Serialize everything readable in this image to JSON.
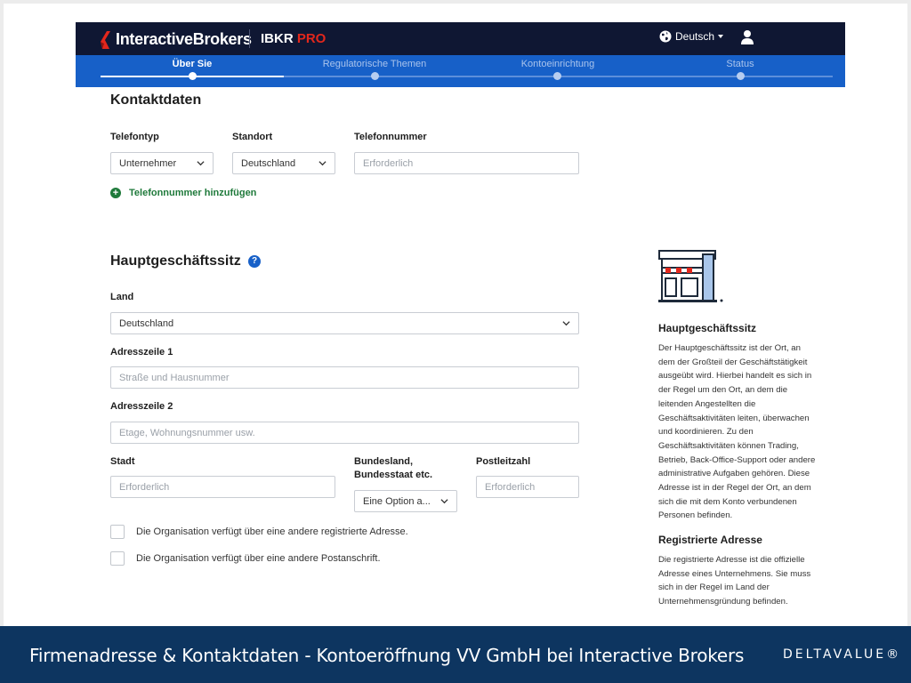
{
  "header": {
    "brand_name": "InteractiveBrokers",
    "product": "IBKR",
    "product_suffix": "PRO",
    "language": "Deutsch"
  },
  "steps": [
    {
      "label": "Über Sie",
      "active": true
    },
    {
      "label": "Regulatorische Themen",
      "active": false
    },
    {
      "label": "Kontoeinrichtung",
      "active": false
    },
    {
      "label": "Status",
      "active": false
    }
  ],
  "contact": {
    "title": "Kontaktdaten",
    "phone_type_label": "Telefontyp",
    "phone_type_value": "Unternehmer",
    "location_label": "Standort",
    "location_value": "Deutschland",
    "phone_label": "Telefonnummer",
    "phone_placeholder": "Erforderlich",
    "add_phone": "Telefonnummer hinzufügen"
  },
  "hq": {
    "title": "Hauptgeschäftssitz",
    "help": "?",
    "country_label": "Land",
    "country_value": "Deutschland",
    "address1_label": "Adresszeile 1",
    "address1_placeholder": "Straße und Hausnummer",
    "address2_label": "Adresszeile 2",
    "address2_placeholder": "Etage, Wohnungsnummer usw.",
    "city_label": "Stadt",
    "city_placeholder": "Erforderlich",
    "state_label_1": "Bundesland,",
    "state_label_2": "Bundesstaat etc.",
    "state_value": "Eine Option a...",
    "zip_label": "Postleitzahl",
    "zip_placeholder": "Erforderlich",
    "checkbox_registered": "Die Organisation verfügt über eine andere registrierte Adresse.",
    "checkbox_postal": "Die Organisation verfügt über eine andere Postanschrift."
  },
  "side": {
    "title1": "Hauptgeschäftssitz",
    "text1": [
      "Der Hauptgeschäftssitz ist der Ort, an",
      "dem der Großteil der Geschäftstätigkeit",
      "ausgeübt wird. Hierbei handelt es sich in",
      "der Regel um den Ort, an dem die",
      "leitenden Angestellten die",
      "Geschäftsaktivitäten leiten, überwachen",
      "und koordinieren. Zu den",
      "Geschäftsaktivitäten können Trading,",
      "Betrieb, Back-Office-Support oder andere",
      "administrative Aufgaben gehören. Diese",
      "Adresse ist in der Regel der Ort, an dem",
      "sich die mit dem Konto verbundenen",
      "Personen befinden."
    ],
    "title2": "Registrierte Adresse",
    "text2": [
      "Die registrierte Adresse ist die offizielle",
      "Adresse eines Unternehmens. Sie muss",
      "sich in der Regel im Land der",
      "Unternehmensgründung befinden."
    ]
  },
  "caption": {
    "text": "Firmenadresse & Kontaktdaten - Kontoeröffnung VV GmbH bei Interactive Brokers",
    "brand": "DELTAVALUE®"
  },
  "colors": {
    "header_bg": "#0f1733",
    "stepbar_bg": "#1760c8",
    "accent_green": "#1f7a3b",
    "caption_bg": "#0d3560",
    "brand_red": "#e2271c"
  }
}
